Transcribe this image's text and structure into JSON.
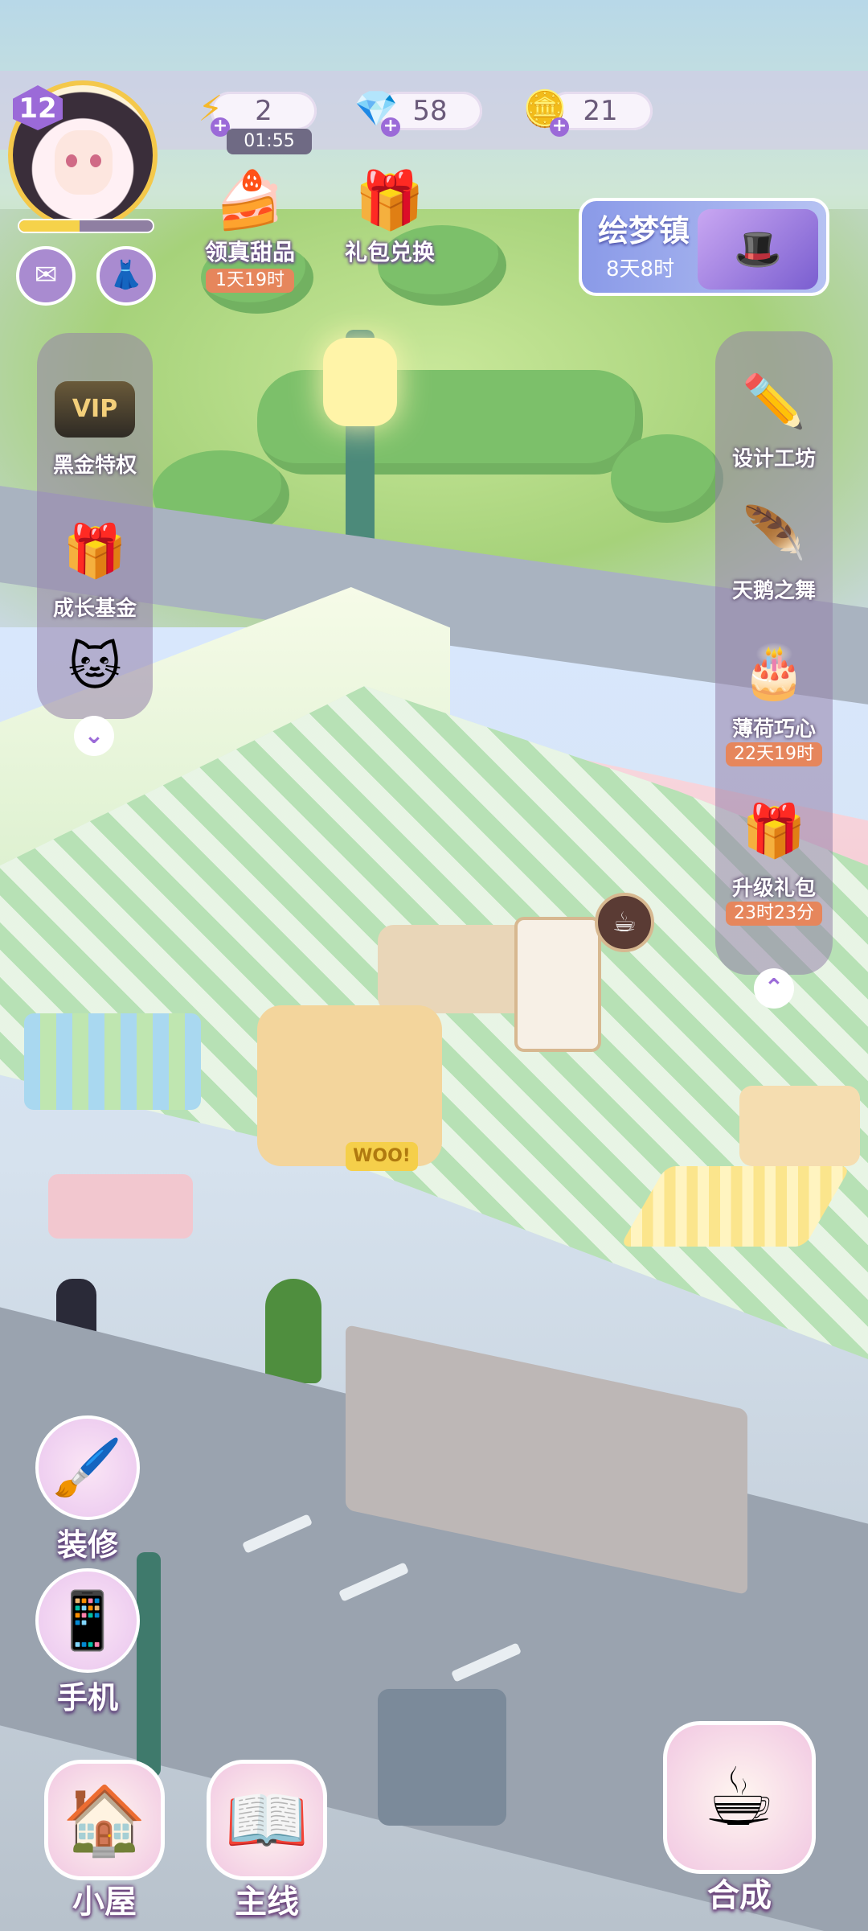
{
  "player": {
    "level": "12",
    "xp_fraction": 0.45
  },
  "currencies": {
    "energy": "2",
    "energy_timer": "01:55",
    "gems": "58",
    "coins": "21"
  },
  "events": [
    {
      "label": "领真甜品",
      "sub": "1天19时",
      "icon": "dessert-icon"
    },
    {
      "label": "礼包兑换",
      "icon": "gift-icon"
    }
  ],
  "town_card": {
    "title": "绘梦镇",
    "sub": "8天8时"
  },
  "left_panel": [
    {
      "label": "黑金特权",
      "badge": "VIP"
    },
    {
      "label": "成长基金"
    },
    {
      "label": ""
    }
  ],
  "right_panel": [
    {
      "label": "设计工坊"
    },
    {
      "label": "天鹅之舞"
    },
    {
      "label": "薄荷巧心",
      "sub": "22天19时"
    },
    {
      "label": "升级礼包",
      "sub": "23时23分"
    }
  ],
  "actions": [
    {
      "label": "装修",
      "icon": "brush-icon"
    },
    {
      "label": "手机",
      "icon": "phone-icon"
    }
  ],
  "dock": [
    {
      "label": "小屋",
      "icon": "house-icon"
    },
    {
      "label": "主线",
      "icon": "book-icon"
    },
    {
      "label": "合成",
      "icon": "teacup-icon"
    }
  ],
  "scene": {
    "sign_text": "WOO!"
  },
  "colors": {
    "accent": "#9b6ad8",
    "timer_badge": "#e6865c"
  }
}
